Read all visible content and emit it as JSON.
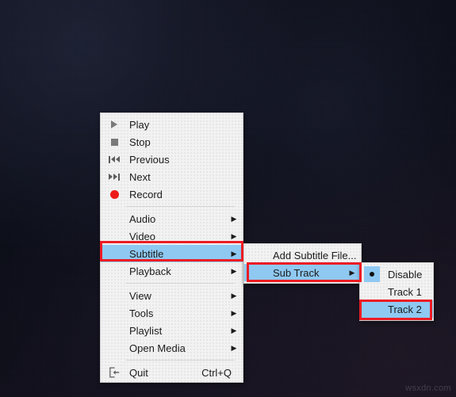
{
  "background": {
    "watermark": "wsxdn.com",
    "color": "#0d0f1a"
  },
  "accent": {
    "highlight": "#8fc9f2",
    "focus_outline": "#ec1c24",
    "record_red": "#ee1b1b"
  },
  "context_menu": {
    "items": [
      {
        "label": "Play",
        "icon": "play-icon",
        "accel": "",
        "arrow": false
      },
      {
        "label": "Stop",
        "icon": "stop-icon",
        "accel": "",
        "arrow": false
      },
      {
        "label": "Previous",
        "icon": "previous-icon",
        "accel": "",
        "arrow": false
      },
      {
        "label": "Next",
        "icon": "next-icon",
        "accel": "",
        "arrow": false
      },
      {
        "label": "Record",
        "icon": "record-icon",
        "accel": "",
        "arrow": false
      },
      {
        "label": "Audio",
        "icon": "",
        "accel": "",
        "arrow": true
      },
      {
        "label": "Video",
        "icon": "",
        "accel": "",
        "arrow": true
      },
      {
        "label": "Subtitle",
        "icon": "",
        "accel": "",
        "arrow": true,
        "selected": true
      },
      {
        "label": "Playback",
        "icon": "",
        "accel": "",
        "arrow": true
      },
      {
        "label": "View",
        "icon": "",
        "accel": "",
        "arrow": true
      },
      {
        "label": "Tools",
        "icon": "",
        "accel": "",
        "arrow": true
      },
      {
        "label": "Playlist",
        "icon": "",
        "accel": "",
        "arrow": true
      },
      {
        "label": "Open Media",
        "icon": "",
        "accel": "",
        "arrow": true
      },
      {
        "label": "Quit",
        "icon": "quit-icon",
        "accel": "Ctrl+Q",
        "arrow": false
      }
    ]
  },
  "subtitle_menu": {
    "items": [
      {
        "label": "Add Subtitle File...",
        "arrow": false
      },
      {
        "label": "Sub Track",
        "arrow": true,
        "selected": true
      }
    ]
  },
  "track_menu": {
    "items": [
      {
        "label": "Disable",
        "checked": true,
        "selected": false
      },
      {
        "label": "Track 1",
        "checked": false,
        "selected": false
      },
      {
        "label": "Track 2",
        "checked": false,
        "selected": true
      }
    ]
  },
  "arrow_glyph": "▶"
}
